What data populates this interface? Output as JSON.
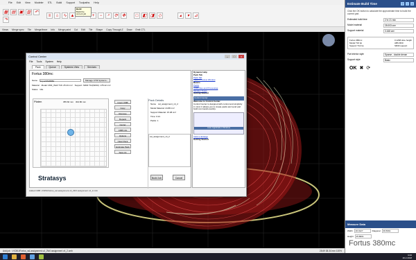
{
  "menubar": {
    "items": [
      "File",
      "Edit",
      "View",
      "Modeler",
      "STL",
      "Build",
      "Support",
      "Toolpaths",
      "Help"
    ]
  },
  "toolbar": {
    "groups": [
      "Merge spec",
      "Tile",
      "Merge/Struct",
      "Info",
      "Merge paint",
      "Cut",
      "Edit",
      "Tile",
      "Shape",
      "Copy Through Z",
      "Draw",
      "Emit CTL"
    ]
  },
  "tooltip": {
    "title": "Build",
    "text": "Build the current job"
  },
  "tabstrip": {
    "items": [
      "Views",
      "Merge spec",
      "Tile",
      "Merge/Inner",
      "Info",
      "Merge paint",
      "Cut",
      "Edit",
      "Tile",
      "Shape",
      "Copy Through Z",
      "Draw",
      "Emit CTL"
    ]
  },
  "statusbar": {
    "left": "Add job : V:\\D5U\\Fortus_ssl-assignment-v4_2\\b6 assignment v4_2.cmb",
    "right": "28.69 38.34 mm   100%"
  },
  "taskbar": {
    "time": "9:00",
    "date": "26.2.2018"
  },
  "right_panel": {
    "title": "Estimate Build Time",
    "desc": "Click the OK button to calculate the approximate time to build the current part.",
    "rows": [
      {
        "label": "Estimated build time",
        "value": "2 hr 21 min"
      },
      {
        "label": "Model material",
        "value": "25.003 cm³"
      },
      {
        "label": "Support material",
        "value": "3.168 cm³"
      }
    ],
    "box": {
      "left": "Fortus 380mc\nModel T16 tip\nSupport T12 tip",
      "right": "0.1268 slice height\nABS M30\nSR30 support"
    },
    "rows2": [
      {
        "label": "Part interior style",
        "value": "Sparse - double dense"
      },
      {
        "label": "Support style",
        "value": "Basic"
      }
    ],
    "ok": "OK"
  },
  "measure": {
    "title": "Measure Data",
    "width_label": "Width",
    "width": "26.0127",
    "height_label": "Height",
    "height": "25.8001",
    "diag_label": "Diagonal",
    "diag": "36.5691"
  },
  "brand": "Fortus 380mc",
  "dialog": {
    "title": "Control Center",
    "menu": [
      "File",
      "Tools",
      "System",
      "Help"
    ],
    "tabs": [
      "Pack",
      "Queue",
      "Systems View",
      "Services"
    ],
    "printer": "Fortus 380mc",
    "name_label": "Name",
    "name_value": "import0626884",
    "manage_btn": "Manage CTM Systems...",
    "material_label": "Material",
    "material_value": "Model: M30_ISLR  T16: 25.43 cm³",
    "support_text": "Support: SR30  T12(SR30): 178.42 cm³",
    "status_label": "Status",
    "status_value": "Idle",
    "platen_title": "Platen",
    "platen_w": "355.60 mm",
    "platen_h": "304.80 mm",
    "mid_buttons": [
      "Insert CMB",
      "Copy",
      "Remove",
      "Repack",
      "Center",
      "CMB Info",
      "Options",
      "Clear Pack",
      "Estimate Pack",
      "Save As"
    ],
    "pack_title": "Pack Details",
    "pack_name_label": "Name",
    "pack_name": "ssl_assignment_v4_2",
    "pack_rows": [
      "Model Material: 24.88 cm³",
      "Support Material: 15.38 cm³",
      "Time: 0:21",
      "Packs: 1"
    ],
    "pack_item": "ssl_assignment_v4_2",
    "logo": "Stratasys",
    "build_btn": "Build Job",
    "cancel_btn": "Cancel",
    "footer": "Added CMB: 2:\\D5U\\fortus_ssl-assignment-v4_2\\b6 assignment v4_2.cmb"
  },
  "help": {
    "title": "Dynamic Help",
    "sections": [
      {
        "h": "Pack Tab",
        "links": [
          "Pack Tab",
          "Platen Preview Window"
        ]
      },
      {
        "h": "Basics",
        "links": [
          "Packs",
          "CMB Files and Processing",
          "Modeler Types"
        ]
      },
      {
        "h": "Getting Started",
        "links": []
      }
    ],
    "bar": "Control Center",
    "welcome": "Welcome to Control Center",
    "text": "Control Center is designed with control and simplicity in mind. It allows you to create packs and send part build commands quickly.",
    "shot_caption": "Auto Application Window",
    "enlarge": "Click to Enlarge",
    "getting": "Getting Started"
  }
}
